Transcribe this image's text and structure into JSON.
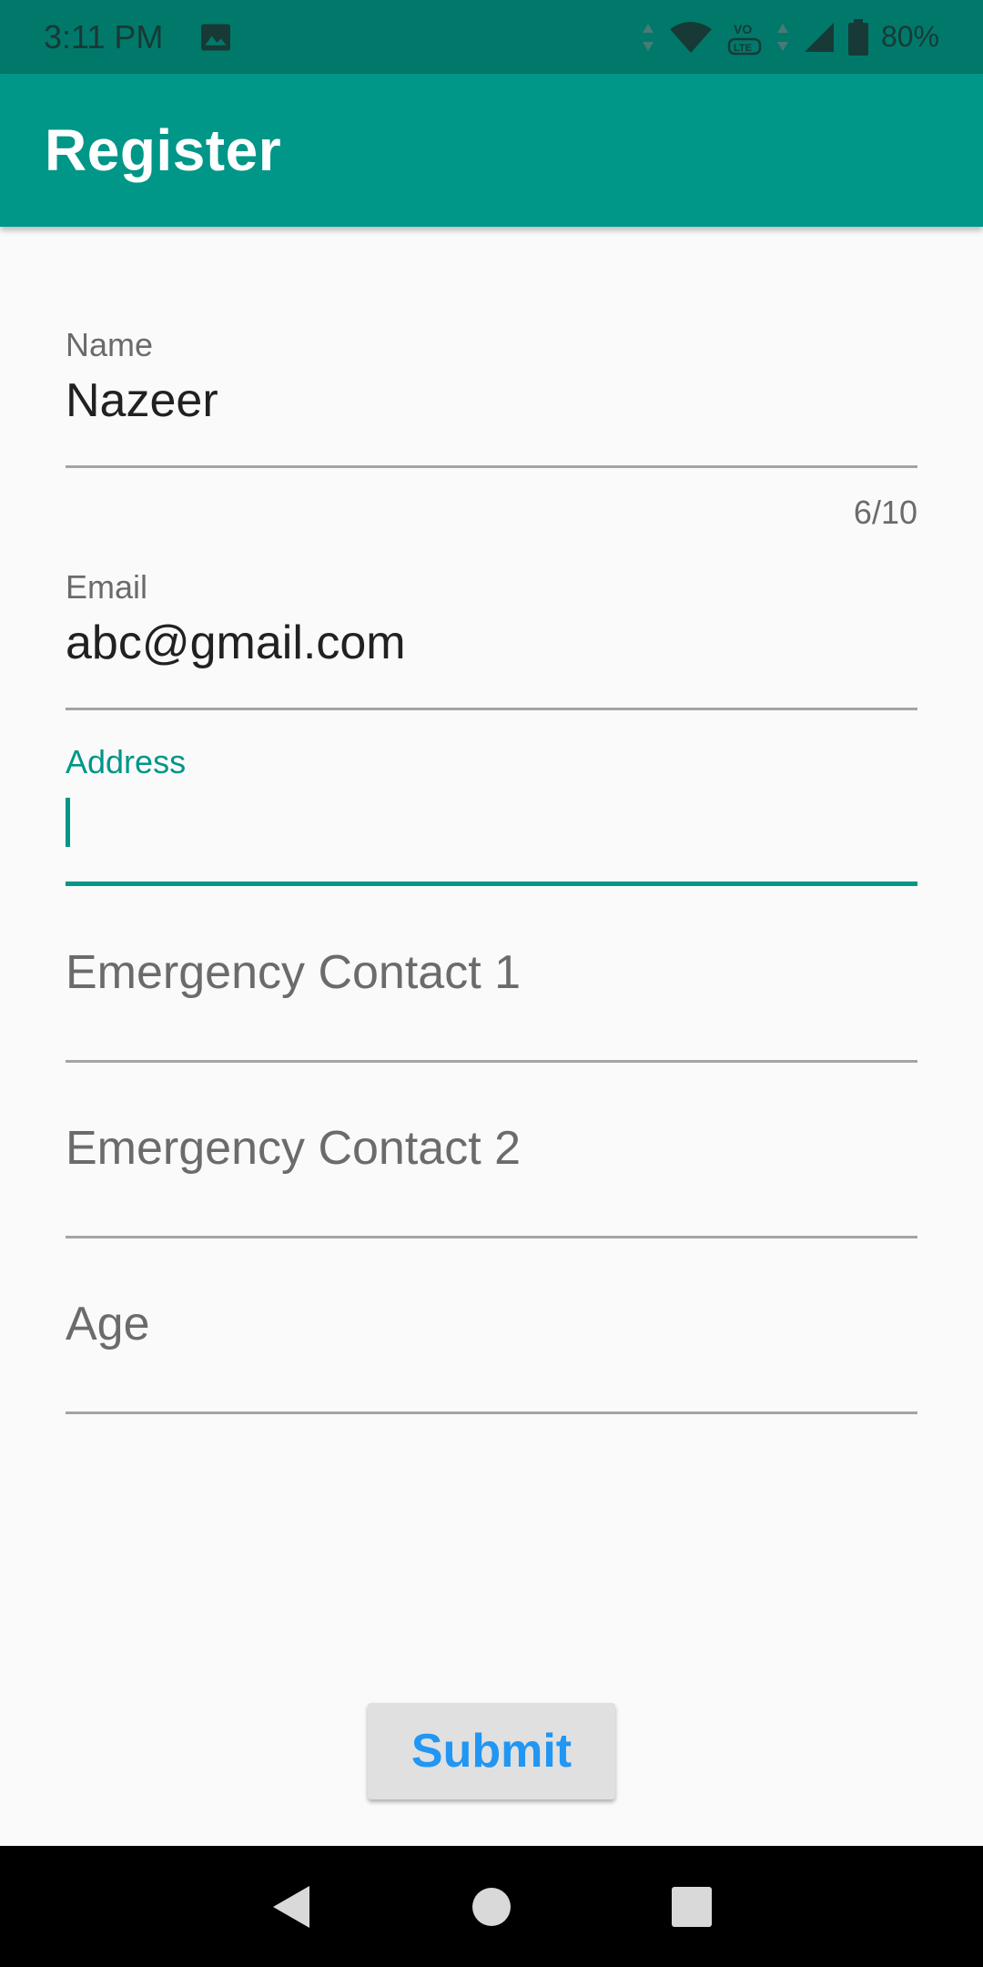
{
  "status_bar": {
    "time": "3:11 PM",
    "battery": "80%",
    "icons": [
      "image-icon",
      "data-arrows-icon",
      "wifi-icon",
      "volte-icon",
      "signal-icon",
      "battery-icon"
    ]
  },
  "app_bar": {
    "title": "Register"
  },
  "form": {
    "name": {
      "label": "Name",
      "value": "Nazeer",
      "counter": "6/10"
    },
    "email": {
      "label": "Email",
      "value": "abc@gmail.com"
    },
    "address": {
      "label": "Address",
      "value": ""
    },
    "emergency_contact_1": {
      "placeholder": "Emergency Contact 1"
    },
    "emergency_contact_2": {
      "placeholder": "Emergency Contact 2"
    },
    "age": {
      "placeholder": "Age"
    }
  },
  "submit": {
    "label": "Submit"
  },
  "colors": {
    "accent": "#009688",
    "status_bar": "#00796b",
    "button_text": "#2196f3"
  }
}
